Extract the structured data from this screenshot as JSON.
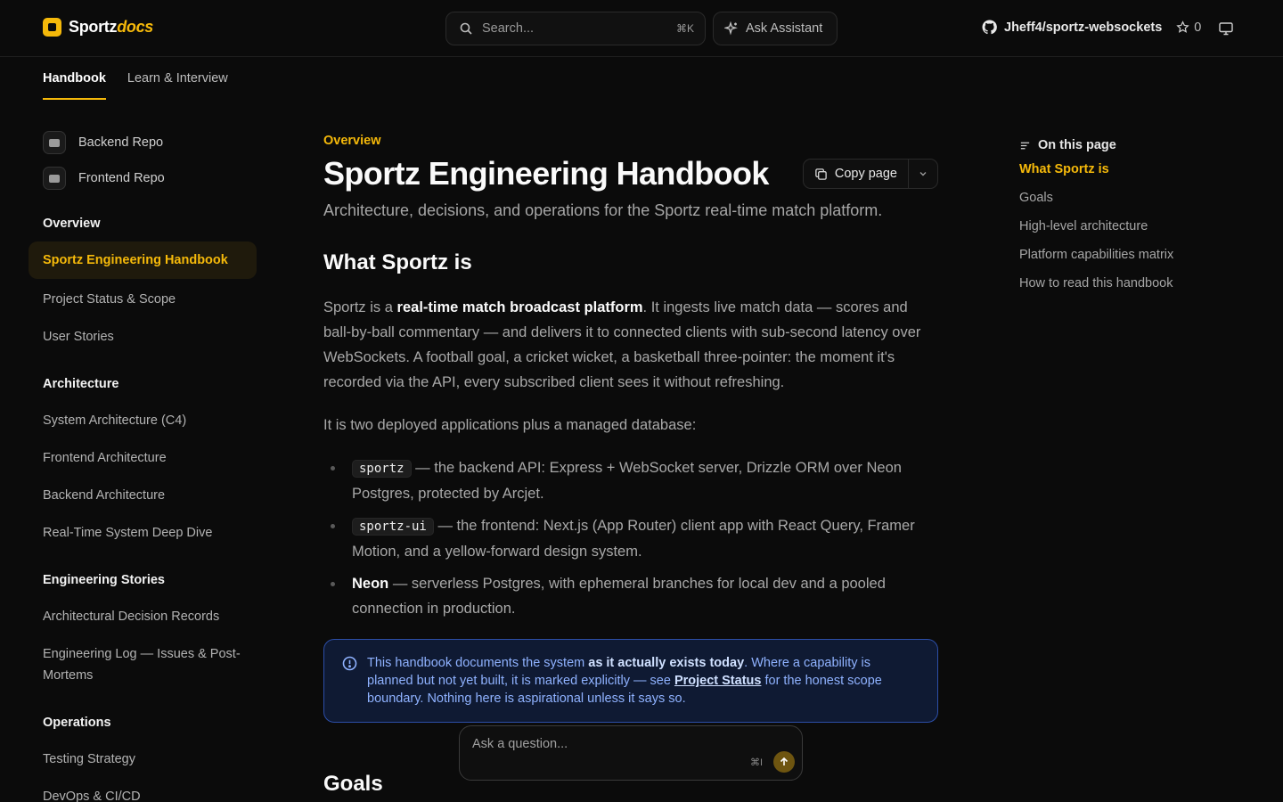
{
  "brand": {
    "name": "Sportz",
    "suffix": "docs",
    "accent": "#f5b90a"
  },
  "header": {
    "search_placeholder": "Search...",
    "search_shortcut": "⌘K",
    "assistant_label": "Ask Assistant",
    "repo_name": "Jheff4/sportz-websockets",
    "star_count": "0"
  },
  "tabs": [
    {
      "label": "Handbook",
      "active": true
    },
    {
      "label": "Learn & Interview",
      "active": false
    }
  ],
  "sidebar": {
    "repos": [
      {
        "label": "Backend Repo",
        "icon": "server-icon"
      },
      {
        "label": "Frontend Repo",
        "icon": "window-icon"
      }
    ],
    "sections": [
      {
        "title": "Overview",
        "items": [
          "Sportz Engineering Handbook",
          "Project Status & Scope",
          "User Stories"
        ]
      },
      {
        "title": "Architecture",
        "items": [
          "System Architecture (C4)",
          "Frontend Architecture",
          "Backend Architecture",
          "Real-Time System Deep Dive"
        ]
      },
      {
        "title": "Engineering Stories",
        "items": [
          "Architectural Decision Records",
          "Engineering Log — Issues & Post-Mortems"
        ]
      },
      {
        "title": "Operations",
        "items": [
          "Testing Strategy",
          "DevOps & CI/CD"
        ]
      }
    ]
  },
  "main": {
    "eyebrow": "Overview",
    "title": "Sportz Engineering Handbook",
    "copy_label": "Copy page",
    "subtitle": "Architecture, decisions, and operations for the Sportz real-time match platform.",
    "h2_what": "What Sportz is",
    "p1_a": "Sportz is a ",
    "p1_b": "real-time match broadcast platform",
    "p1_c": ". It ingests live match data — scores and ball-by-ball commentary — and delivers it to connected clients with sub-second latency over WebSockets. A football goal, a cricket wicket, a basketball three-pointer: the moment it's recorded via the API, every subscribed client sees it without refreshing.",
    "p2": "It is two deployed applications plus a managed database:",
    "list": [
      {
        "term": "sportz",
        "text": " — the backend API: Express + WebSocket server, Drizzle ORM over Neon Postgres, protected by Arcjet."
      },
      {
        "term": "sportz-ui",
        "text": " — the frontend: Next.js (App Router) client app with React Query, Framer Motion, and a yellow-forward design system."
      },
      {
        "term": "Neon",
        "text": " — serverless Postgres, with ephemeral branches for local dev and a pooled connection in production."
      }
    ],
    "callout": {
      "a": "This handbook documents the system ",
      "b": "as it actually exists today",
      "c": ". Where a capability is planned but not yet built, it is marked explicitly — see ",
      "link": "Project Status",
      "d": " for the honest scope boundary. Nothing here is aspirational unless it says so."
    },
    "h2_goals": "Goals"
  },
  "ask": {
    "placeholder": "Ask a question...",
    "shortcut": "⌘I"
  },
  "toc": {
    "title": "On this page",
    "items": [
      "What Sportz is",
      "Goals",
      "High-level architecture",
      "Platform capabilities matrix",
      "How to read this handbook"
    ]
  }
}
